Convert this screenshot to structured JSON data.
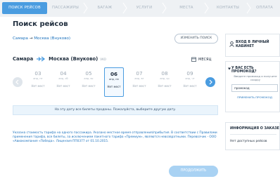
{
  "steps": [
    {
      "label": "ПОИСК РЕЙСОВ",
      "active": true
    },
    {
      "label": "ПАССАЖИРЫ",
      "active": false
    },
    {
      "label": "БАГАЖ",
      "active": false
    },
    {
      "label": "УСЛУГИ",
      "active": false
    },
    {
      "label": "МЕСТА",
      "active": false
    },
    {
      "label": "КОНТАКТЫ",
      "active": false
    },
    {
      "label": "ОПЛАТА",
      "active": false
    }
  ],
  "page_title": "Поиск рейсов",
  "breadcrumb": {
    "from": "Самара",
    "arrow": "→",
    "to": "Москва (Внуково)"
  },
  "change_search_label": "ИЗМЕНИТЬ ПОИСК",
  "route": {
    "from": "Самара",
    "to": "Москва (Внуково)",
    "code": "VKO"
  },
  "month_label": "МЕСЯЦ",
  "days": [
    {
      "num": "03",
      "weekday": "апр, пт",
      "price": "Нет мест",
      "selected": false
    },
    {
      "num": "04",
      "weekday": "апр, сб",
      "price": "Нет мест",
      "selected": false
    },
    {
      "num": "05",
      "weekday": "апр, вс",
      "price": "Нет мест",
      "selected": false
    },
    {
      "num": "06",
      "weekday": "апр, пн",
      "price": "Нет мест",
      "selected": true
    },
    {
      "num": "07",
      "weekday": "апр, вт",
      "price": "Нет мест",
      "selected": false
    },
    {
      "num": "08",
      "weekday": "апр, ср",
      "price": "Нет мест",
      "selected": false
    },
    {
      "num": "09",
      "weekday": "апр, чт",
      "price": "Нет мест",
      "selected": false
    }
  ],
  "notice": "На эту дату все билеты проданы. Пожалуйста, выберите другую дату.",
  "footnote": "Указана стоимость тарифа на одного пассажира. Указано местное время отправления/прибытия. В соответствии с Правилами применения тарифа, все билеты, за исключением пакетного тарифа «Премиум», являются невозвратными. Перевозчик - ООО «Авиакомпания «Победа». Лицензия ПП0377 от 01.10.2015.",
  "continue_label": "ПРОДОЛЖИТЬ",
  "sidebar": {
    "cabinet_label": "ВХОД В ЛИЧНЫЙ КАБИНЕТ",
    "promo_title": "У ВАС ЕСТЬ ПРОМОКОД?",
    "promo_hint": "Введите промокод и получите скидку",
    "promo_value": "промокод",
    "promo_apply": "ПРИМЕНИТЬ ПРОМОКОД",
    "order_title": "ИНФОРМАЦИЯ О ЗАКАЗЕ",
    "order_empty": "Нет доступных рейсов"
  },
  "colors": {
    "accent": "#4a9ce0",
    "link": "#1e73be",
    "disabled_button": "#a9d2f3",
    "notice_bg": "#eaf4fc"
  },
  "icons": [
    "plane-icon",
    "calendar-icon",
    "chevron-left-icon",
    "chevron-right-icon",
    "user-icon",
    "triangle-down-icon"
  ]
}
